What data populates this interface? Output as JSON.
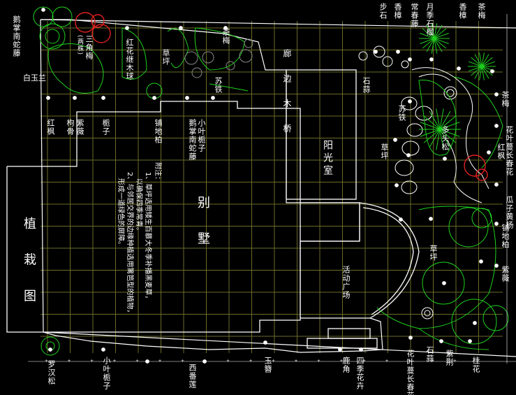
{
  "drawing": {
    "title": "植 栽 图",
    "villa": "别 墅",
    "sunroom": "阳光室",
    "activity": "活动广场",
    "pavilion": "廊 边 木 桥",
    "notes": {
      "heading": "附注：",
      "line1": "1、草坪选用矮生百慕大冬季补播黑麦草，",
      "line1b": "以确保四季常青。",
      "line2": "2、与邻居交界的边缘种植选用篱笆型的植物，",
      "line2b": "形成一道绿色的屏障。"
    }
  },
  "labels": {
    "l01": "鹅掌南蛇藤",
    "l02": "白玉兰",
    "l03": "三角梅",
    "l04": "(两株)",
    "l05": "红花继木球",
    "l06": "草坪",
    "l07": "小叶栀子",
    "l08": "鹅掌南蛇藤",
    "l09": "铺地柏",
    "l10": "苏铁",
    "l11": "茶梅",
    "l12": "栀子",
    "l13": "紫薇",
    "l14": "枸骨",
    "l15": "红枫",
    "l16": "桂花",
    "l17": "草坪",
    "l18": "石蒜",
    "l19": "步石",
    "l20": "香樟",
    "l21": "月季石榴",
    "l22": "常春藤",
    "l23": "香樟",
    "l24": "茶梅",
    "l25": "苏铁",
    "l26": "花叶蔓长春花",
    "l27": "红枫",
    "l28": "瓜子黄杨",
    "l29": "茶梅",
    "l30": "铺地柏",
    "l31": "紫薇",
    "l32": "草坪",
    "l33": "多头松",
    "l34": "石蒜",
    "l35": "花叶蔓长春花",
    "l36": "玉簪",
    "l37": "紫荆",
    "l38": "紫木槿",
    "l39": "桂花",
    "l40": "四季花卉",
    "l41": "鹿角",
    "l42": "麦冬",
    "l43": "西番莲",
    "l44": "小叶栀子",
    "l45": "罗汉松",
    "l46": "凤尾竹",
    "l47": "含笑",
    "l48": "桂花"
  },
  "colors": {
    "grid": "#6b6b2a",
    "green": "#1fd01f",
    "white": "#ffffff",
    "red": "#e02020"
  }
}
